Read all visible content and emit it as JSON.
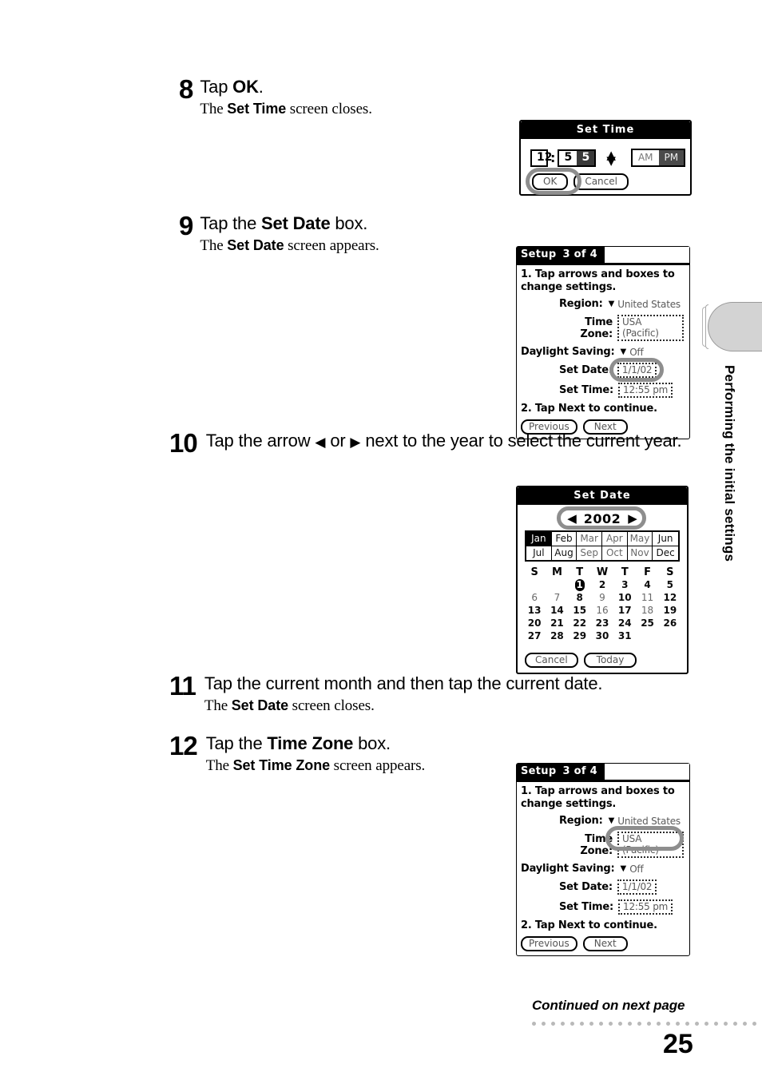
{
  "page": {
    "number": "25",
    "continued": "Continued on next page",
    "side_tab_label": "Performing the initial settings"
  },
  "steps": [
    {
      "num": "8",
      "title_parts": [
        "Tap ",
        "OK",
        "."
      ],
      "sub_parts": [
        "The ",
        "Set Time",
        " screen closes."
      ]
    },
    {
      "num": "9",
      "title_parts": [
        "Tap the ",
        "Set Date",
        " box."
      ],
      "sub_parts": [
        "The ",
        "Set Date",
        " screen appears."
      ]
    },
    {
      "num": "10",
      "title_parts": [
        "Tap the arrow ",
        "◀",
        " or ",
        "▶",
        " next to the year to select the current year."
      ],
      "sub_parts": []
    },
    {
      "num": "11",
      "title_parts": [
        "Tap the current month and then tap the current date."
      ],
      "sub_parts": [
        "The ",
        "Set Date",
        " screen closes."
      ]
    },
    {
      "num": "12",
      "title_parts": [
        "Tap the ",
        "Time Zone",
        " box."
      ],
      "sub_parts": [
        "The ",
        "Set Time Zone",
        " screen appears."
      ]
    }
  ],
  "set_time_dialog": {
    "title": "Set Time",
    "hour": "12",
    "colon": ":",
    "minute_tens": "5",
    "minute_ones": "5",
    "spin_up": "▲",
    "spin_down": "▼",
    "am": "AM",
    "pm": "PM",
    "ok": "OK",
    "cancel": "Cancel"
  },
  "setup_screen_date": {
    "tab_title": "Setup",
    "tab_step": "3 of 4",
    "instruction_1": "1. Tap arrows and boxes to",
    "instruction_1b": "change settings.",
    "region_label": "Region:",
    "region_value": "United States",
    "timezone_label": "Time Zone:",
    "timezone_value": "USA (Pacific)",
    "dst_label": "Daylight Saving:",
    "dst_value": "Off",
    "setdate_label": "Set Date:",
    "setdate_value": "1/1/02",
    "settime_label": "Set Time:",
    "settime_value": "12:55 pm",
    "instruction_2": "2. Tap Next to continue.",
    "previous": "Previous",
    "next": "Next",
    "caret": "▼"
  },
  "set_date_dialog": {
    "title": "Set Date",
    "year": "2002",
    "left_arrow": "◀",
    "right_arrow": "▶",
    "months": [
      "Jan",
      "Feb",
      "Mar",
      "Apr",
      "May",
      "Jun",
      "Jul",
      "Aug",
      "Sep",
      "Oct",
      "Nov",
      "Dec"
    ],
    "selected_month": "Jan",
    "dow": [
      "S",
      "M",
      "T",
      "W",
      "T",
      "F",
      "S"
    ],
    "weeks": [
      [
        "",
        "",
        "1",
        "2",
        "3",
        "4",
        "5"
      ],
      [
        "6",
        "7",
        "8",
        "9",
        "10",
        "11",
        "12"
      ],
      [
        "13",
        "14",
        "15",
        "16",
        "17",
        "18",
        "19"
      ],
      [
        "20",
        "21",
        "22",
        "23",
        "24",
        "25",
        "26"
      ],
      [
        "27",
        "28",
        "29",
        "30",
        "31",
        "",
        ""
      ]
    ],
    "selected_day": "1",
    "cancel": "Cancel",
    "today": "Today"
  },
  "setup_screen_tz": {
    "tab_title": "Setup",
    "tab_step": "3 of 4",
    "instruction_1": "1. Tap arrows and boxes to",
    "instruction_1b": "change settings.",
    "region_label": "Region:",
    "region_value": "United States",
    "timezone_label": "Time Zone:",
    "timezone_value": "USA (Pacific)",
    "dst_label": "Daylight Saving:",
    "dst_value": "Off",
    "setdate_label": "Set Date:",
    "setdate_value": "1/1/02",
    "settime_label": "Set Time:",
    "settime_value": "12:55 pm",
    "instruction_2": "2. Tap Next to continue.",
    "previous": "Previous",
    "next": "Next",
    "caret": "▼"
  },
  "colors": {
    "highlight_ring": "#8e8e8e",
    "tab_gray": "#d3d3d3",
    "dot_gray": "#b9b9b9"
  }
}
